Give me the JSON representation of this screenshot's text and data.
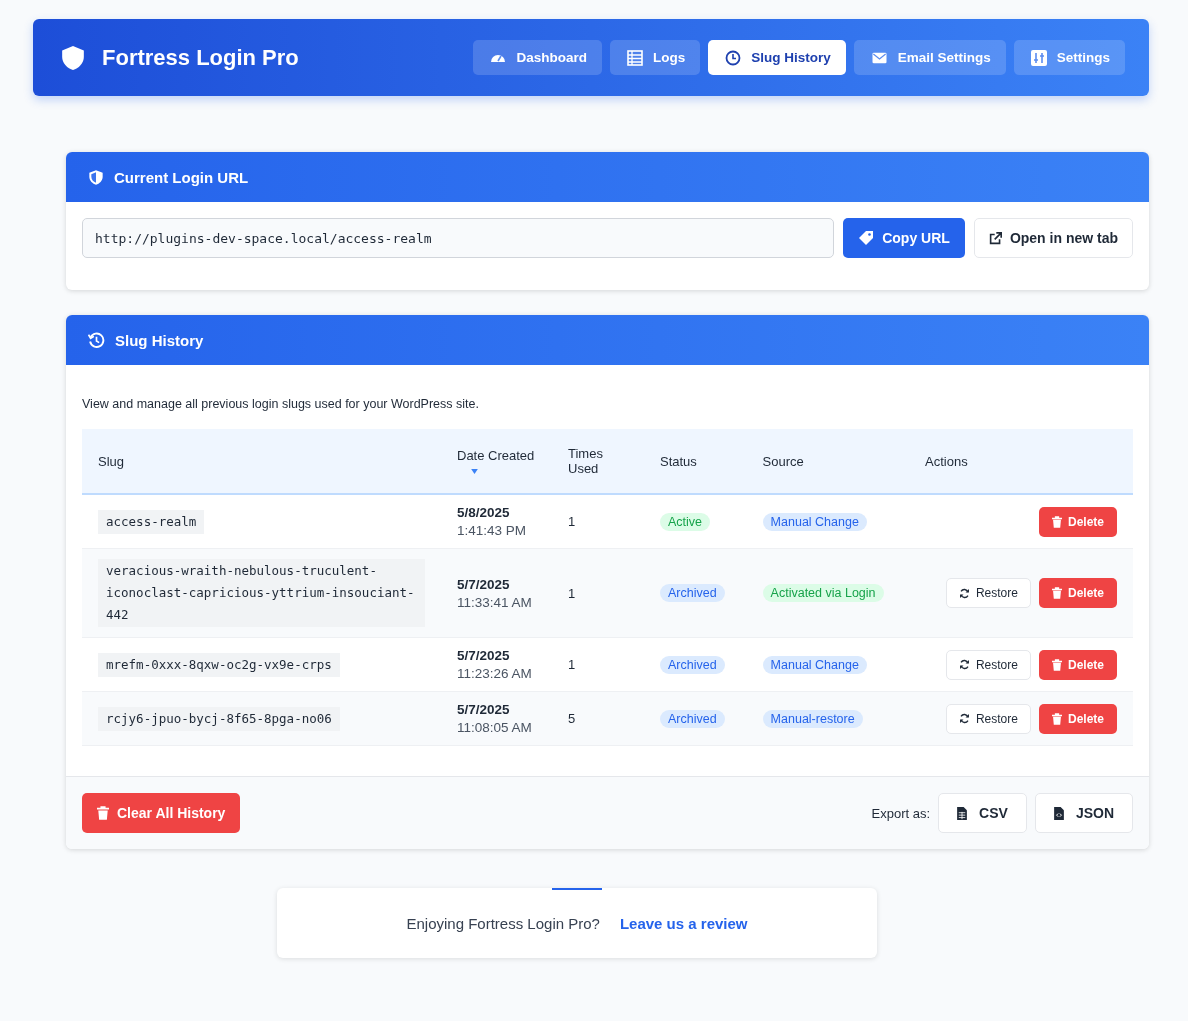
{
  "header": {
    "title": "Fortress Login Pro",
    "tabs": [
      {
        "label": "Dashboard",
        "selected": false
      },
      {
        "label": "Logs",
        "selected": false
      },
      {
        "label": "Slug History",
        "selected": true
      },
      {
        "label": "Email Settings",
        "selected": false
      },
      {
        "label": "Settings",
        "selected": false
      }
    ]
  },
  "current_url": {
    "title": "Current Login URL",
    "value": "http://plugins-dev-space.local/access-realm",
    "copy_button": "Copy URL",
    "open_button": "Open in new tab"
  },
  "history": {
    "title": "Slug History",
    "description": "View and manage all previous login slugs used for your WordPress site.",
    "columns": [
      {
        "label": "Slug",
        "sorted": false
      },
      {
        "label": "Date Created",
        "sorted": true
      },
      {
        "label": "Times Used",
        "sorted": false
      },
      {
        "label": "Status",
        "sorted": false
      },
      {
        "label": "Source",
        "sorted": false
      },
      {
        "label": "Actions",
        "sorted": false
      }
    ],
    "rows": [
      {
        "slug": "access-realm",
        "date": "5/8/2025",
        "time": "1:41:43 PM",
        "times_used": "1",
        "status": {
          "label": "Active",
          "kind": "green"
        },
        "source": {
          "label": "Manual Change",
          "kind": "blue"
        },
        "actions": [
          {
            "label": "Delete",
            "kind": "delete"
          }
        ]
      },
      {
        "slug": "veracious-wraith-nebulous-truculent-iconoclast-capricious-yttrium-insouciant-442",
        "date": "5/7/2025",
        "time": "11:33:41 AM",
        "times_used": "1",
        "status": {
          "label": "Archived",
          "kind": "blue"
        },
        "source": {
          "label": "Activated via Login",
          "kind": "green"
        },
        "actions": [
          {
            "label": "Restore",
            "kind": "restore"
          },
          {
            "label": "Delete",
            "kind": "delete"
          }
        ]
      },
      {
        "slug": "mrefm-0xxx-8qxw-oc2g-vx9e-crps",
        "date": "5/7/2025",
        "time": "11:23:26 AM",
        "times_used": "1",
        "status": {
          "label": "Archived",
          "kind": "blue"
        },
        "source": {
          "label": "Manual Change",
          "kind": "blue"
        },
        "actions": [
          {
            "label": "Restore",
            "kind": "restore"
          },
          {
            "label": "Delete",
            "kind": "delete"
          }
        ]
      },
      {
        "slug": "rcjy6-jpuo-bycj-8f65-8pga-no06",
        "date": "5/7/2025",
        "time": "11:08:05 AM",
        "times_used": "5",
        "status": {
          "label": "Archived",
          "kind": "blue"
        },
        "source": {
          "label": "Manual-restore",
          "kind": "blue"
        },
        "actions": [
          {
            "label": "Restore",
            "kind": "restore"
          },
          {
            "label": "Delete",
            "kind": "delete"
          }
        ]
      }
    ],
    "clear_button": "Clear All History",
    "export_label": "Export as:",
    "export_buttons": [
      {
        "label": "CSV",
        "kind": "csv"
      },
      {
        "label": "JSON",
        "kind": "json"
      }
    ]
  },
  "footer": {
    "text": "Enjoying Fortress Login Pro?",
    "link": "Leave us a review"
  }
}
